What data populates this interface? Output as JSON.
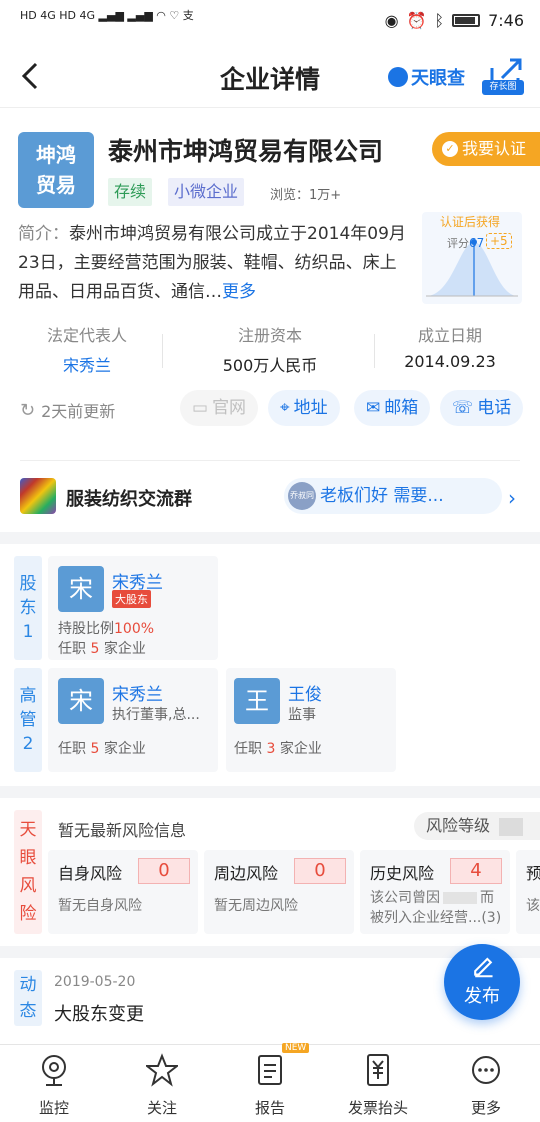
{
  "status_bar": {
    "left_indicators": "HD 4G HD 4G",
    "time": "7:46"
  },
  "header": {
    "title": "企业详情",
    "brand": "天眼查",
    "save_image_label": "存长图"
  },
  "company": {
    "logo_text_line1": "坤鸿",
    "logo_text_line2": "贸易",
    "name": "泰州市坤鸿贸易有限公司",
    "verify_label": "我要认证",
    "status_tag": "存续",
    "size_tag": "小微企业",
    "views": "浏览：1万+",
    "intro_label": "简介：",
    "intro_text": "泰州市坤鸿贸易有限公司成立于2014年09月23日，主要经营范围为服装、鞋帽、纺织品、床上用品、日用品百货、通信…",
    "intro_more": "更多"
  },
  "promo": {
    "title": "认证后获得",
    "score_label": "评分",
    "score": "67",
    "plus": "+5"
  },
  "info": {
    "legal_rep_label": "法定代表人",
    "legal_rep": "宋秀兰",
    "capital_label": "注册资本",
    "capital": "500万人民币",
    "founded_label": "成立日期",
    "founded": "2014.09.23"
  },
  "actions": {
    "updated": "2天前更新",
    "website": "官网",
    "address": "地址",
    "email": "邮箱",
    "phone": "电话"
  },
  "group": {
    "name": "服装纺织交流群",
    "avatar_text": "乔叔同",
    "message": "老板们好 需要..."
  },
  "shareholders": {
    "side_label": "股东",
    "count": "1",
    "items": [
      {
        "avatar": "宋",
        "name": "宋秀兰",
        "badge": "大股东",
        "ratio_label": "持股比例",
        "ratio": "100%",
        "jobs_prefix": "任职",
        "jobs_count": "5",
        "jobs_suffix": "家企业"
      }
    ]
  },
  "executives": {
    "side_label": "高管",
    "count": "2",
    "items": [
      {
        "avatar": "宋",
        "name": "宋秀兰",
        "role": "执行董事,总...",
        "jobs_prefix": "任职",
        "jobs_count": "5",
        "jobs_suffix": "家企业"
      },
      {
        "avatar": "王",
        "name": "王俊",
        "role": "监事",
        "jobs_prefix": "任职",
        "jobs_count": "3",
        "jobs_suffix": "家企业"
      }
    ]
  },
  "risk": {
    "side_label": "天眼风险",
    "headline": "暂无最新风险信息",
    "level_label": "风险等级",
    "cards": [
      {
        "title": "自身风险",
        "count": "0",
        "desc": "暂无自身风险"
      },
      {
        "title": "周边风险",
        "count": "0",
        "desc": "暂无周边风险"
      },
      {
        "title": "历史风险",
        "count": "4",
        "desc_line1": "该公司曾因",
        "desc_line1_end": "而",
        "desc_line2": "被列入企业经营...(3)"
      },
      {
        "title": "预",
        "desc": "该公"
      }
    ]
  },
  "news": {
    "side_label": "动态",
    "date": "2019-05-20",
    "title": "大股东变更"
  },
  "fab": {
    "label": "发布"
  },
  "bottom_nav": [
    {
      "label": "监控",
      "icon": "camera-icon"
    },
    {
      "label": "关注",
      "icon": "star-icon"
    },
    {
      "label": "报告",
      "icon": "document-icon",
      "badge": "NEW"
    },
    {
      "label": "发票抬头",
      "icon": "invoice-icon"
    },
    {
      "label": "更多",
      "icon": "more-icon"
    }
  ],
  "colors": {
    "brand_blue": "#1b74e4",
    "verify_orange": "#f5a623",
    "risk_red": "#e74c3c"
  }
}
